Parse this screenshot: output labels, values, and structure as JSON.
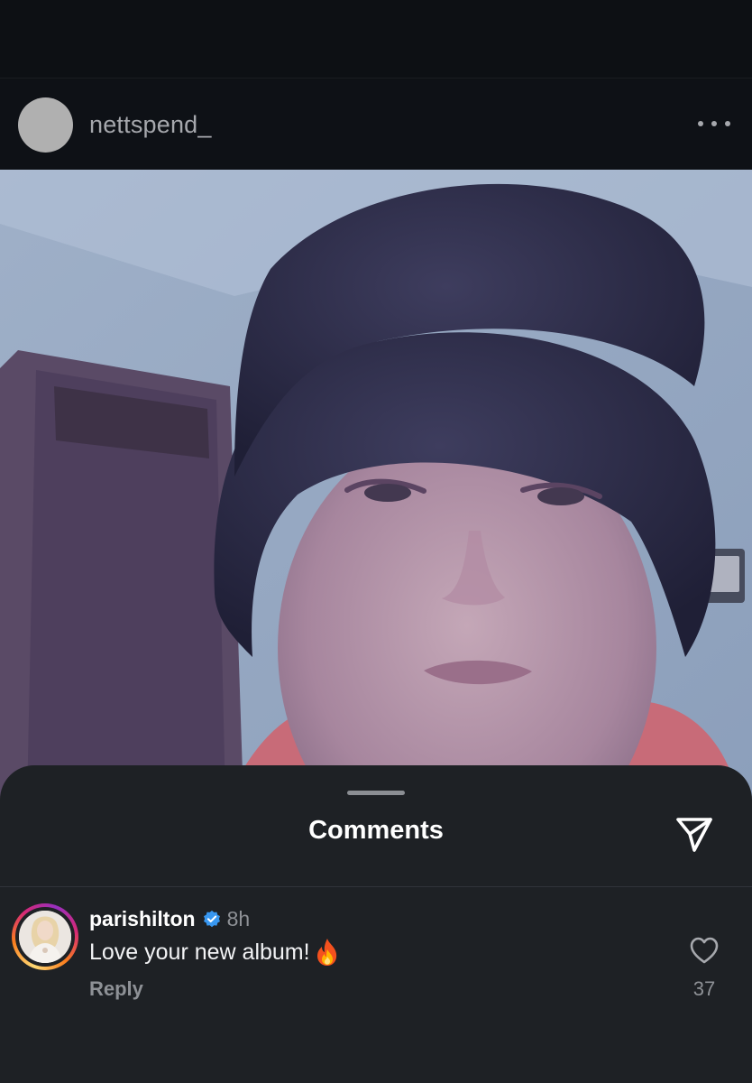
{
  "post": {
    "username": "nettspend_"
  },
  "comments_sheet": {
    "title": "Comments"
  },
  "comment": {
    "username": "parishilton",
    "time": "8h",
    "text": "Love your new album!",
    "reply_label": "Reply",
    "like_count": "37"
  },
  "icons": {
    "more": "more-horizontal-icon",
    "share": "send-paper-plane-icon",
    "verified": "verified-badge-icon",
    "fire": "fire-emoji-icon",
    "like": "heart-outline-icon"
  },
  "colors": {
    "background": "#0d1014",
    "sheet": "#1e2125",
    "verified_blue": "#3897f0",
    "muted_text": "#8e9196"
  }
}
